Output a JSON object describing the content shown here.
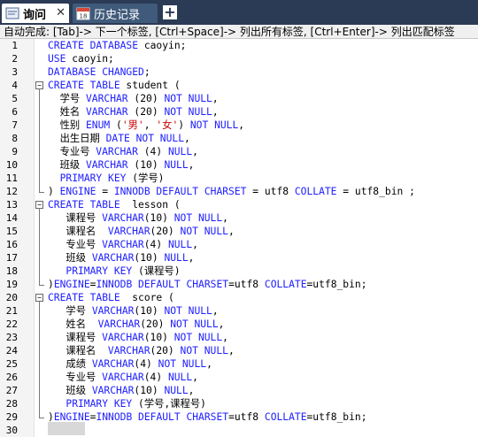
{
  "tabs": [
    {
      "label": "询问",
      "active": true,
      "icon": "query-icon"
    },
    {
      "label": "历史记录",
      "active": false,
      "icon": "calendar-icon"
    }
  ],
  "hint_text": "自动完成: [Tab]-> 下一个标签, [Ctrl+Space]-> 列出所有标签, [Ctrl+Enter]-> 列出匹配标签",
  "colors": {
    "keyword": "#2020ff",
    "string": "#cc0000",
    "tabbar": "#2b3a55"
  },
  "lines": [
    {
      "n": "1",
      "tokens": [
        [
          "kw",
          "CREATE DATABASE "
        ],
        [
          "t",
          "caoyin;"
        ]
      ]
    },
    {
      "n": "2",
      "tokens": [
        [
          "kw",
          "USE "
        ],
        [
          "t",
          "caoyin;"
        ]
      ]
    },
    {
      "n": "3",
      "tokens": [
        [
          "kw",
          "DATABASE CHANGED"
        ],
        [
          "t",
          ";"
        ]
      ]
    },
    {
      "n": "4",
      "fold": true,
      "tokens": [
        [
          "kw",
          "CREATE TABLE "
        ],
        [
          "t",
          "student ("
        ]
      ]
    },
    {
      "n": "5",
      "tokens": [
        [
          "t",
          "  学号 "
        ],
        [
          "kw",
          "VARCHAR "
        ],
        [
          "t",
          "(20) "
        ],
        [
          "kw",
          "NOT NULL"
        ],
        [
          "t",
          ","
        ]
      ]
    },
    {
      "n": "6",
      "tokens": [
        [
          "t",
          "  姓名 "
        ],
        [
          "kw",
          "VARCHAR "
        ],
        [
          "t",
          "(20) "
        ],
        [
          "kw",
          "NOT NULL"
        ],
        [
          "t",
          ","
        ]
      ]
    },
    {
      "n": "7",
      "tokens": [
        [
          "t",
          "  性别 "
        ],
        [
          "kw",
          "ENUM "
        ],
        [
          "t",
          "("
        ],
        [
          "str",
          "'男'"
        ],
        [
          "t",
          ", "
        ],
        [
          "str",
          "'女'"
        ],
        [
          "t",
          ") "
        ],
        [
          "kw",
          "NOT NULL"
        ],
        [
          "t",
          ","
        ]
      ]
    },
    {
      "n": "8",
      "tokens": [
        [
          "t",
          "  出生日期 "
        ],
        [
          "kw",
          "DATE NOT NULL"
        ],
        [
          "t",
          ","
        ]
      ]
    },
    {
      "n": "9",
      "tokens": [
        [
          "t",
          "  专业号 "
        ],
        [
          "kw",
          "VARCHAR "
        ],
        [
          "t",
          "(4) "
        ],
        [
          "kw",
          "NULL"
        ],
        [
          "t",
          ","
        ]
      ]
    },
    {
      "n": "10",
      "tokens": [
        [
          "t",
          "  班级 "
        ],
        [
          "kw",
          "VARCHAR "
        ],
        [
          "t",
          "(10) "
        ],
        [
          "kw",
          "NULL"
        ],
        [
          "t",
          ","
        ]
      ]
    },
    {
      "n": "11",
      "tokens": [
        [
          "t",
          "  "
        ],
        [
          "kw",
          "PRIMARY KEY "
        ],
        [
          "t",
          "(学号)"
        ]
      ]
    },
    {
      "n": "12",
      "end": true,
      "tokens": [
        [
          "t",
          ") "
        ],
        [
          "kw",
          "ENGINE "
        ],
        [
          "t",
          "= "
        ],
        [
          "kw",
          "INNODB DEFAULT CHARSET "
        ],
        [
          "t",
          "= utf8 "
        ],
        [
          "kw",
          "COLLATE "
        ],
        [
          "t",
          "= utf8_bin ;"
        ]
      ]
    },
    {
      "n": "13",
      "fold": true,
      "tokens": [
        [
          "kw",
          "CREATE TABLE "
        ],
        [
          "t",
          " lesson ("
        ]
      ]
    },
    {
      "n": "14",
      "tokens": [
        [
          "t",
          "   课程号 "
        ],
        [
          "kw",
          "VARCHAR"
        ],
        [
          "t",
          "(10) "
        ],
        [
          "kw",
          "NOT NULL"
        ],
        [
          "t",
          ","
        ]
      ]
    },
    {
      "n": "15",
      "tokens": [
        [
          "t",
          "   课程名  "
        ],
        [
          "kw",
          "VARCHAR"
        ],
        [
          "t",
          "(20) "
        ],
        [
          "kw",
          "NOT NULL"
        ],
        [
          "t",
          ","
        ]
      ]
    },
    {
      "n": "16",
      "tokens": [
        [
          "t",
          "   专业号 "
        ],
        [
          "kw",
          "VARCHAR"
        ],
        [
          "t",
          "(4) "
        ],
        [
          "kw",
          "NULL"
        ],
        [
          "t",
          ","
        ]
      ]
    },
    {
      "n": "17",
      "tokens": [
        [
          "t",
          "   班级 "
        ],
        [
          "kw",
          "VARCHAR"
        ],
        [
          "t",
          "(10) "
        ],
        [
          "kw",
          "NULL"
        ],
        [
          "t",
          ","
        ]
      ]
    },
    {
      "n": "18",
      "tokens": [
        [
          "t",
          "   "
        ],
        [
          "kw",
          "PRIMARY KEY "
        ],
        [
          "t",
          "(课程号)"
        ]
      ]
    },
    {
      "n": "19",
      "end": true,
      "tokens": [
        [
          "t",
          ")"
        ],
        [
          "kw",
          "ENGINE"
        ],
        [
          "t",
          "="
        ],
        [
          "kw",
          "INNODB DEFAULT CHARSET"
        ],
        [
          "t",
          "=utf8 "
        ],
        [
          "kw",
          "COLLATE"
        ],
        [
          "t",
          "=utf8_bin;"
        ]
      ]
    },
    {
      "n": "20",
      "fold": true,
      "tokens": [
        [
          "kw",
          "CREATE TABLE "
        ],
        [
          "t",
          " score ("
        ]
      ]
    },
    {
      "n": "21",
      "tokens": [
        [
          "t",
          "   学号 "
        ],
        [
          "kw",
          "VARCHAR"
        ],
        [
          "t",
          "(10) "
        ],
        [
          "kw",
          "NOT NULL"
        ],
        [
          "t",
          ","
        ]
      ]
    },
    {
      "n": "22",
      "tokens": [
        [
          "t",
          "   姓名  "
        ],
        [
          "kw",
          "VARCHAR"
        ],
        [
          "t",
          "(20) "
        ],
        [
          "kw",
          "NOT NULL"
        ],
        [
          "t",
          ","
        ]
      ]
    },
    {
      "n": "23",
      "tokens": [
        [
          "t",
          "   课程号 "
        ],
        [
          "kw",
          "VARCHAR"
        ],
        [
          "t",
          "(10) "
        ],
        [
          "kw",
          "NOT NULL"
        ],
        [
          "t",
          ","
        ]
      ]
    },
    {
      "n": "24",
      "tokens": [
        [
          "t",
          "   课程名  "
        ],
        [
          "kw",
          "VARCHAR"
        ],
        [
          "t",
          "(20) "
        ],
        [
          "kw",
          "NOT NULL"
        ],
        [
          "t",
          ","
        ]
      ]
    },
    {
      "n": "25",
      "tokens": [
        [
          "t",
          "   成绩 "
        ],
        [
          "kw",
          "VARCHAR"
        ],
        [
          "t",
          "(4) "
        ],
        [
          "kw",
          "NOT NULL"
        ],
        [
          "t",
          ","
        ]
      ]
    },
    {
      "n": "26",
      "tokens": [
        [
          "t",
          "   专业号 "
        ],
        [
          "kw",
          "VARCHAR"
        ],
        [
          "t",
          "(4) "
        ],
        [
          "kw",
          "NULL"
        ],
        [
          "t",
          ","
        ]
      ]
    },
    {
      "n": "27",
      "tokens": [
        [
          "t",
          "   班级 "
        ],
        [
          "kw",
          "VARCHAR"
        ],
        [
          "t",
          "(10) "
        ],
        [
          "kw",
          "NULL"
        ],
        [
          "t",
          ","
        ]
      ]
    },
    {
      "n": "28",
      "tokens": [
        [
          "t",
          "   "
        ],
        [
          "kw",
          "PRIMARY KEY "
        ],
        [
          "t",
          "(学号,课程号)"
        ]
      ]
    },
    {
      "n": "29",
      "end": true,
      "tokens": [
        [
          "t",
          ")"
        ],
        [
          "kw",
          "ENGINE"
        ],
        [
          "t",
          "="
        ],
        [
          "kw",
          "INNODB DEFAULT CHARSET"
        ],
        [
          "t",
          "=utf8 "
        ],
        [
          "kw",
          "COLLATE"
        ],
        [
          "t",
          "=utf8_bin;"
        ]
      ]
    },
    {
      "n": "30",
      "tokens": []
    }
  ]
}
